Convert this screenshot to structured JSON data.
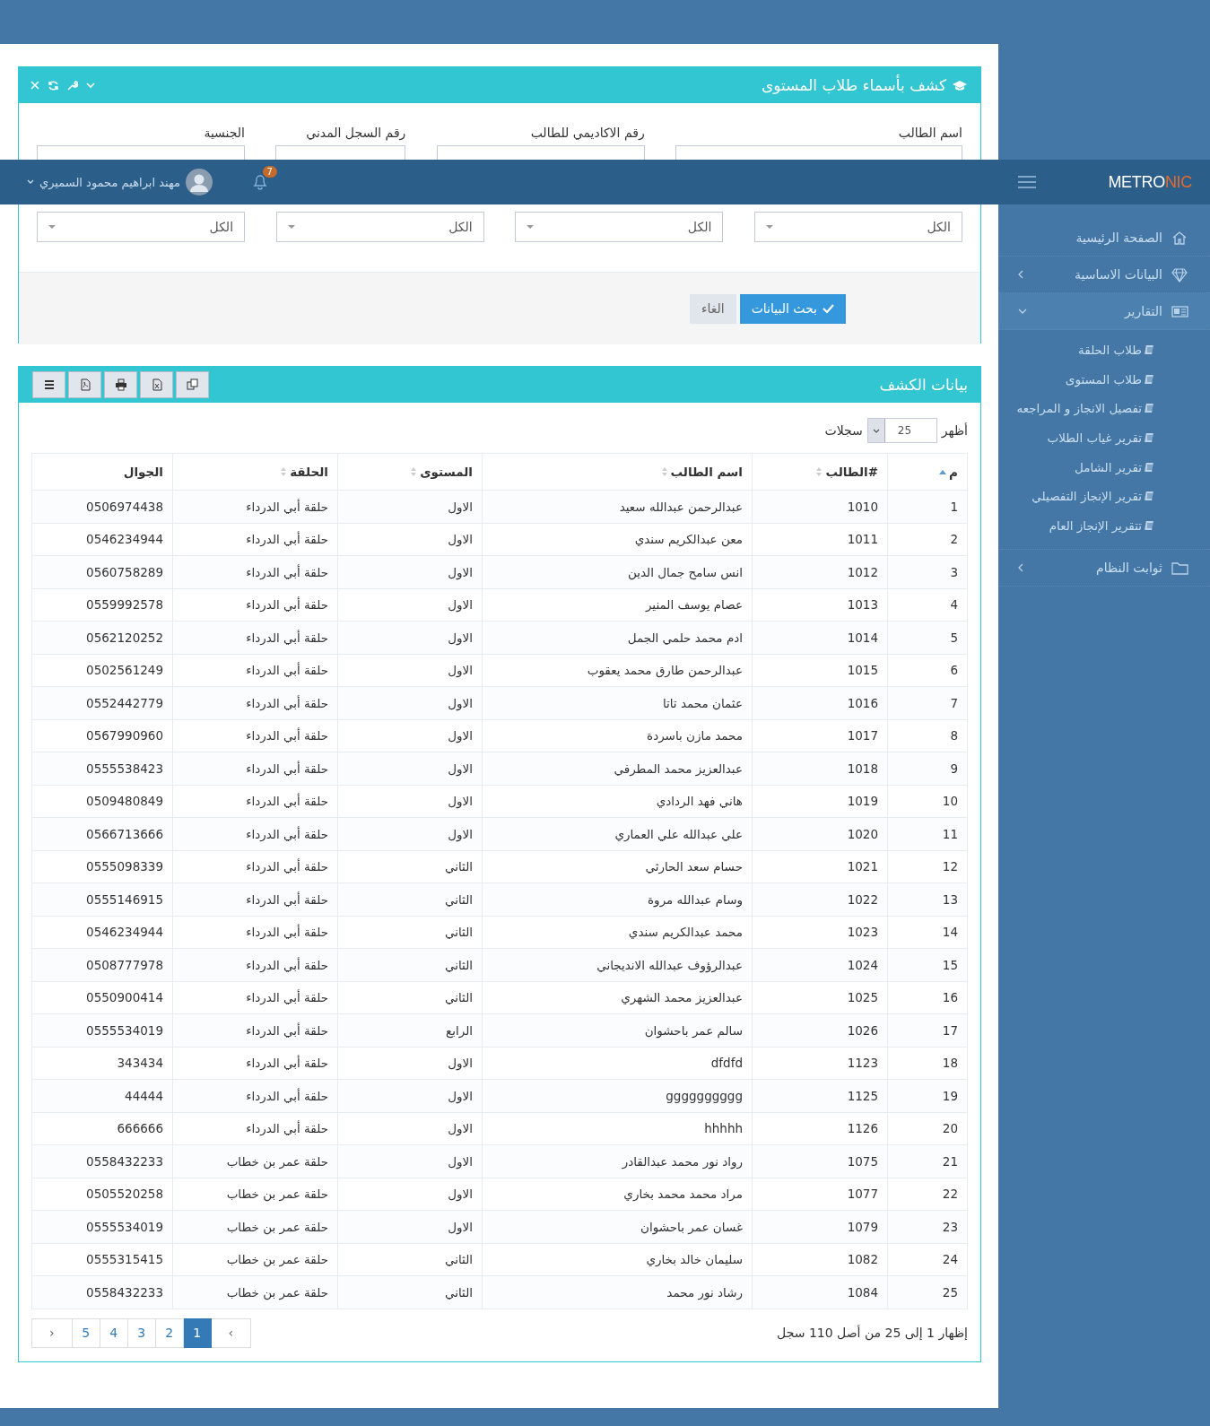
{
  "topbar": {
    "logo": {
      "main": "METRO",
      "accent": "NIC"
    },
    "notifications": "7",
    "user": "مهند ابراهيم محمود السميري"
  },
  "sidebar": {
    "items": [
      {
        "kind": "link",
        "label": "الصفحة الرئيسية"
      },
      {
        "kind": "group",
        "label": "البيانات الاساسية",
        "expanded": false
      },
      {
        "kind": "group",
        "label": "التقارير",
        "expanded": true,
        "children": [
          {
            "label": "طلاب الحلقة"
          },
          {
            "label": "طلاب المستوى"
          },
          {
            "label": "تفصيل الانجاز و المراجعه"
          },
          {
            "label": "تقرير غياب الطلاب"
          },
          {
            "label": "تقرير الشامل"
          },
          {
            "label": "تقرير الإنجاز التفصيلي"
          },
          {
            "label": "تتقرير الإنجاز العام"
          }
        ]
      },
      {
        "kind": "group",
        "label": "ثوابت النظام",
        "expanded": false
      }
    ]
  },
  "search_panel": {
    "title": "كشف بأسماء طلاب المستوى",
    "fields": [
      {
        "label": "اسم الطالب"
      },
      {
        "label": "رقم الاكاديمي للطالب"
      },
      {
        "label": "رقم السجل المدني"
      },
      {
        "label": "الجنسية"
      }
    ],
    "selects": [
      {
        "value": "الكل"
      },
      {
        "value": "الكل"
      },
      {
        "value": "الكل"
      },
      {
        "value": "الكل"
      }
    ],
    "buttons": [
      {
        "kind": "primary",
        "label": "بحث البيانات"
      },
      {
        "kind": "default",
        "label": "الغاء"
      }
    ]
  },
  "results_panel": {
    "title": "بيانات الكشف",
    "length": {
      "before": "أظهر",
      "value": "25",
      "after": "سجلات"
    },
    "table": {
      "columns": [
        {
          "label": "م",
          "sortable": true,
          "sorted": true
        },
        {
          "label": "#الطالب",
          "sortable": true,
          "sorted": false
        },
        {
          "label": "اسم الطالب",
          "sortable": true,
          "sorted": false
        },
        {
          "label": "المستوى",
          "sortable": true,
          "sorted": false
        },
        {
          "label": "الحلقة",
          "sortable": true,
          "sorted": false
        },
        {
          "label": "الجوال",
          "sortable": false,
          "sorted": false
        }
      ],
      "rows": [
        [
          "1",
          "1010",
          "عبدالرحمن عبدالله سعيد",
          "الاول",
          "حلقة أبي الدرداء",
          "0506974438"
        ],
        [
          "2",
          "1011",
          "معن عبدالكريم سندي",
          "الاول",
          "حلقة أبي الدرداء",
          "0546234944"
        ],
        [
          "3",
          "1012",
          "انس سامح جمال الدين",
          "الاول",
          "حلقة أبي الدرداء",
          "0560758289"
        ],
        [
          "4",
          "1013",
          "عصام يوسف المنير",
          "الاول",
          "حلقة أبي الدرداء",
          "0559992578"
        ],
        [
          "5",
          "1014",
          "ادم محمد حلمي الجمل",
          "الاول",
          "حلقة أبي الدرداء",
          "0562120252"
        ],
        [
          "6",
          "1015",
          "عبدالرحمن طارق محمد يعقوب",
          "الاول",
          "حلقة أبي الدرداء",
          "0502561249"
        ],
        [
          "7",
          "1016",
          "عثمان محمد تاتا",
          "الاول",
          "حلقة أبي الدرداء",
          "0552442779"
        ],
        [
          "8",
          "1017",
          "محمد مازن باسردة",
          "الاول",
          "حلقة أبي الدرداء",
          "0567990960"
        ],
        [
          "9",
          "1018",
          "عبدالعزيز محمد المطرفي",
          "الاول",
          "حلقة أبي الدرداء",
          "0555538423"
        ],
        [
          "10",
          "1019",
          "هاني فهد الردادي",
          "الاول",
          "حلقة أبي الدرداء",
          "0509480849"
        ],
        [
          "11",
          "1020",
          "علي عبدالله علي العماري",
          "الاول",
          "حلقة أبي الدرداء",
          "0566713666"
        ],
        [
          "12",
          "1021",
          "حسام سعد الحارثي",
          "الثاني",
          "حلقة أبي الدرداء",
          "0555098339"
        ],
        [
          "13",
          "1022",
          "وسام عبدالله مروة",
          "الثاني",
          "حلقة أبي الدرداء",
          "0555146915"
        ],
        [
          "14",
          "1023",
          "محمد عبدالكريم سندي",
          "الثاني",
          "حلقة أبي الدرداء",
          "0546234944"
        ],
        [
          "15",
          "1024",
          "عبدالرؤوف عبدالله الانديجاني",
          "الثاني",
          "حلقة أبي الدرداء",
          "0508777978"
        ],
        [
          "16",
          "1025",
          "عبدالعزيز محمد الشهري",
          "الثاني",
          "حلقة أبي الدرداء",
          "0550900414"
        ],
        [
          "17",
          "1026",
          "سالم عمر باحشوان",
          "الرابع",
          "حلقة أبي الدرداء",
          "0555534019"
        ],
        [
          "18",
          "1123",
          "dfdfd",
          "الاول",
          "حلقة أبي الدرداء",
          "343434"
        ],
        [
          "19",
          "1125",
          "gggggggggg",
          "الاول",
          "حلقة أبي الدرداء",
          "44444"
        ],
        [
          "20",
          "1126",
          "hhhhh",
          "الاول",
          "حلقة أبي الدرداء",
          "666666"
        ],
        [
          "21",
          "1075",
          "رواد نور محمد عبدالقادر",
          "الاول",
          "حلقة عمر بن خطاب",
          "0558432233"
        ],
        [
          "22",
          "1077",
          "مراد محمد محمد بخاري",
          "الاول",
          "حلقة عمر بن خطاب",
          "0505520258"
        ],
        [
          "23",
          "1079",
          "غسان عمر باحشوان",
          "الاول",
          "حلقة عمر بن خطاب",
          "0555534019"
        ],
        [
          "24",
          "1082",
          "سليمان خالد بخاري",
          "الثاني",
          "حلقة عمر بن خطاب",
          "0555315415"
        ],
        [
          "25",
          "1084",
          "رشاد نور محمد",
          "الثاني",
          "حلقة عمر بن خطاب",
          "0558432233"
        ]
      ]
    },
    "info": "إظهار 1 إلى 25 من أصل 110 سجل",
    "pagination": [
      {
        "label": "›",
        "selected": false
      },
      {
        "label": "1",
        "selected": true
      },
      {
        "label": "2",
        "selected": false
      },
      {
        "label": "3",
        "selected": false
      },
      {
        "label": "4",
        "selected": false
      },
      {
        "label": "5",
        "selected": false
      },
      {
        "label": "‹",
        "selected": false
      }
    ]
  }
}
